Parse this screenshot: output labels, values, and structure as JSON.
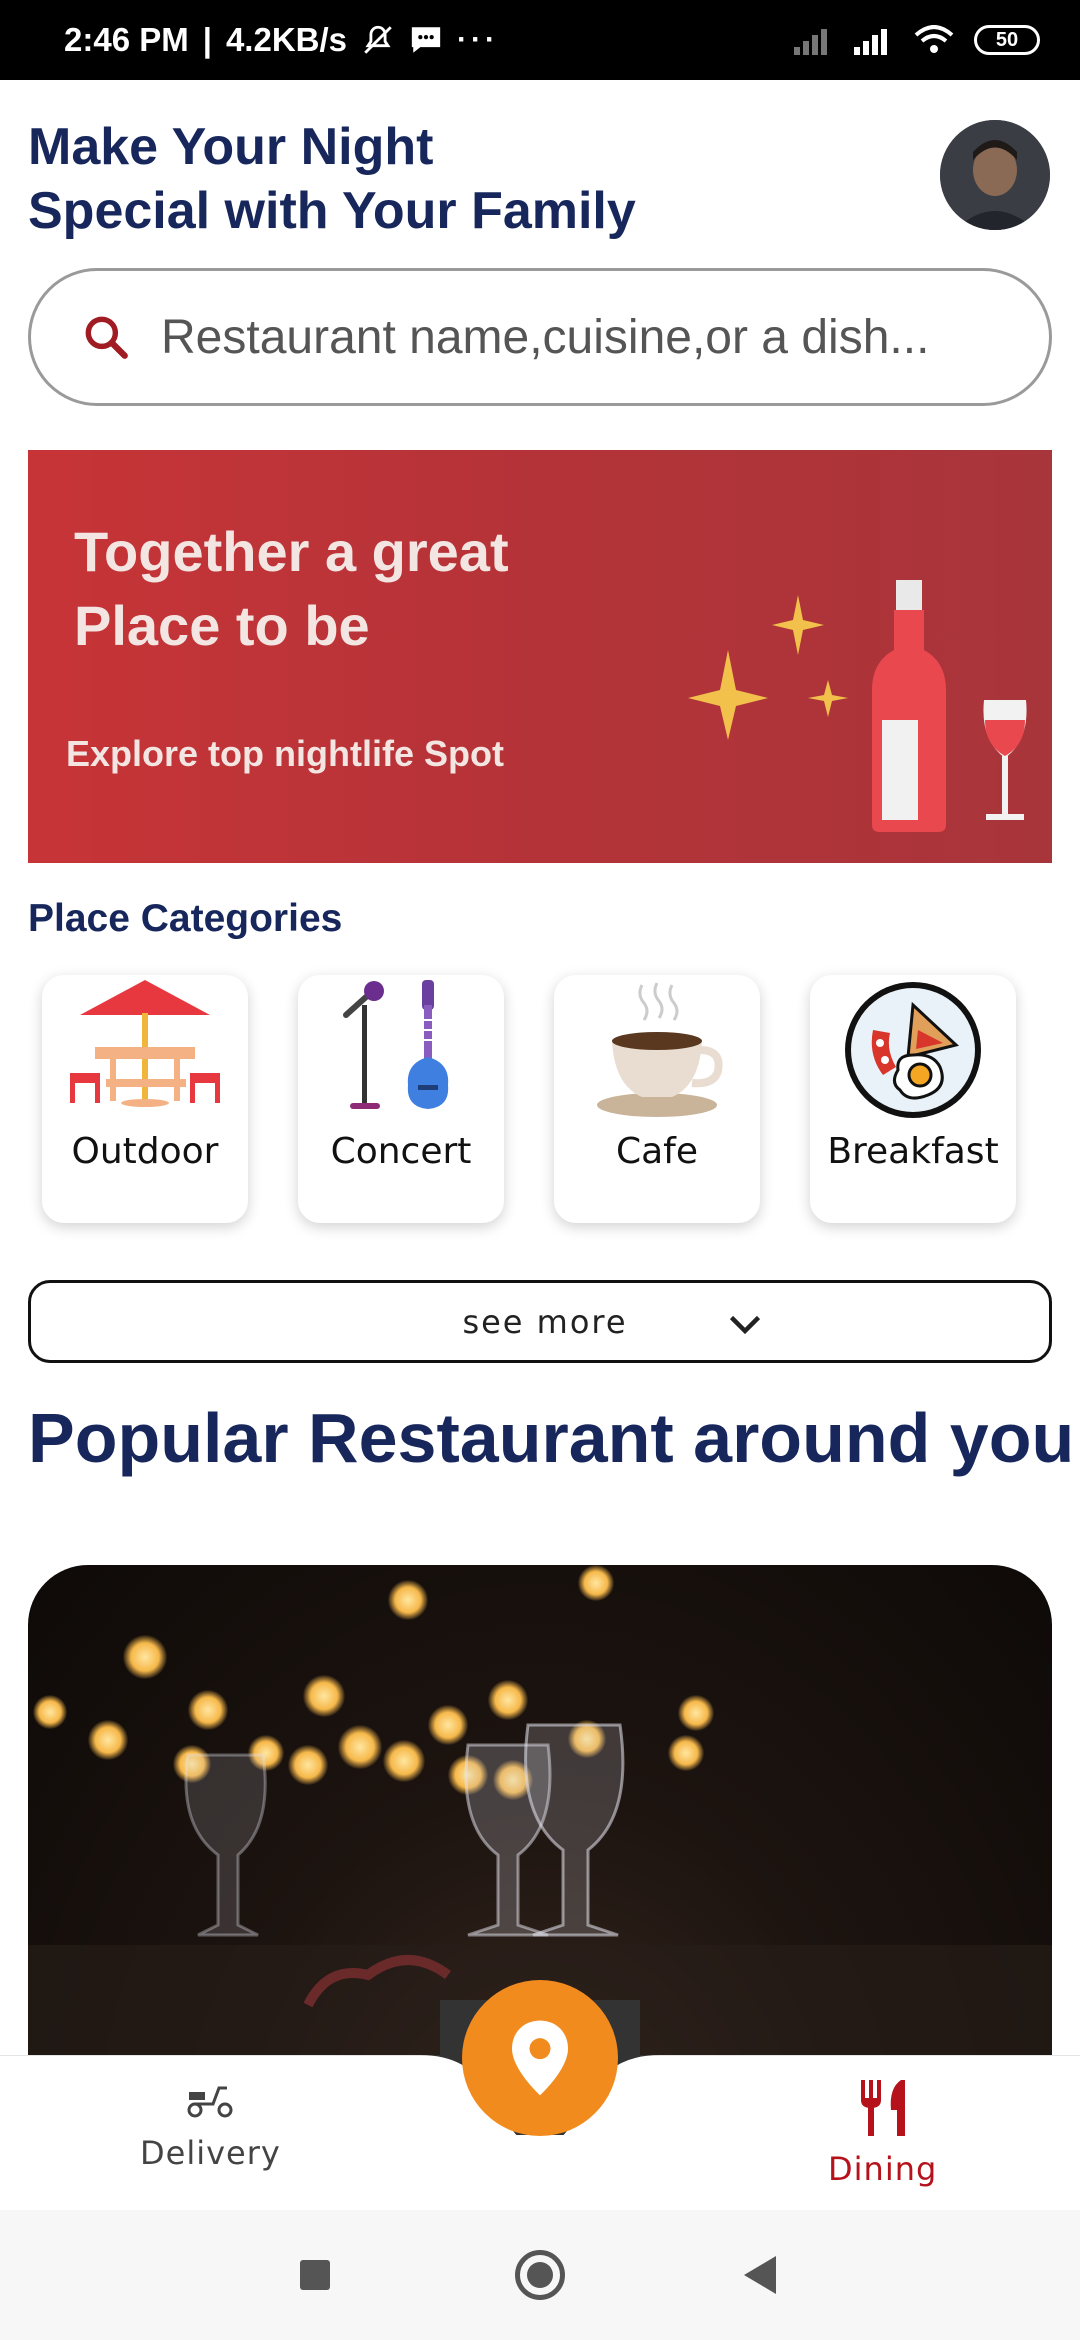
{
  "status_bar": {
    "time": "2:46 PM",
    "network_speed": "4.2KB/s",
    "battery": "50",
    "icons": [
      "mute-icon",
      "message-icon",
      "more-icon",
      "signal-icon",
      "signal-icon",
      "wifi-icon",
      "battery-icon"
    ]
  },
  "header": {
    "title_line1": "Make Your Night",
    "title_line2": "Special with Your Family",
    "avatar_icon": "user-avatar"
  },
  "search": {
    "placeholder": "Restaurant name,cuisine,or a dish...",
    "icon": "search-icon"
  },
  "banner": {
    "title_line1": "Together a great",
    "title_line2": "Place to be",
    "subtitle": "Explore top nightlife Spot",
    "art": "wine-bottle-and-glass"
  },
  "categories": {
    "label": "Place Categories",
    "items": [
      {
        "label": "Outdoor",
        "icon": "outdoor-table-icon"
      },
      {
        "label": "Concert",
        "icon": "microphone-guitar-icon"
      },
      {
        "label": "Cafe",
        "icon": "coffee-cup-icon"
      },
      {
        "label": "Breakfast",
        "icon": "breakfast-plate-icon"
      }
    ]
  },
  "see_more": {
    "label": "see more",
    "icon": "chevron-down-icon"
  },
  "popular": {
    "title": "Popular Restaurant around you"
  },
  "bottom_nav": {
    "delivery": {
      "label": "Delivery",
      "icon": "scooter-icon"
    },
    "fab": {
      "icon": "location-pin-icon"
    },
    "dining": {
      "label": "Dining",
      "icon": "fork-knife-icon",
      "active": true
    }
  },
  "colors": {
    "title": "#17275c",
    "banner": "#b43338",
    "fab": "#f28b1e",
    "active_tab": "#b5121b",
    "inactive_tab": "#444444"
  }
}
